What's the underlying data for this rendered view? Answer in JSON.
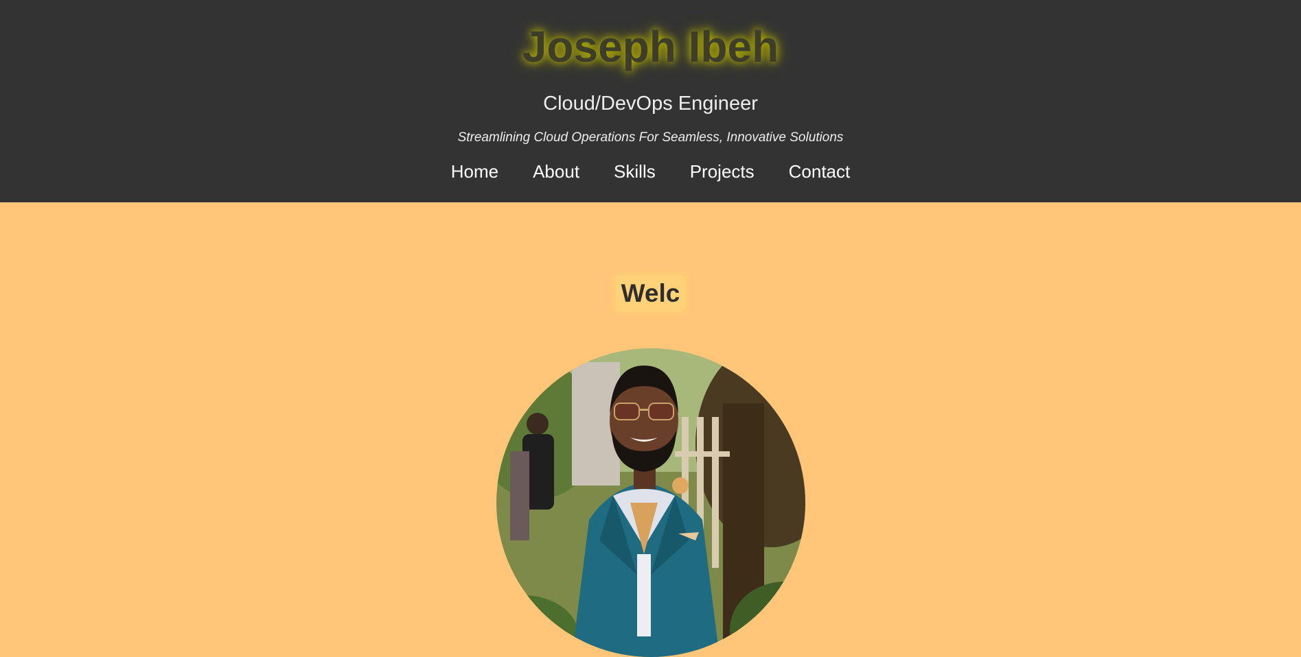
{
  "header": {
    "name": "Joseph Ibeh",
    "role": "Cloud/DevOps Engineer",
    "tagline": "Streamlining Cloud Operations For Seamless, Innovative Solutions"
  },
  "nav": {
    "items": [
      {
        "label": "Home"
      },
      {
        "label": "About"
      },
      {
        "label": "Skills"
      },
      {
        "label": "Projects"
      },
      {
        "label": "Contact"
      }
    ]
  },
  "hero": {
    "welcome_text": "Welc",
    "profile_photo": "profile-photo"
  },
  "colors": {
    "header_bg": "#333333",
    "page_bg": "#ffc67a",
    "name_glow": "#c7c400",
    "welcome_bg": "#ffd27a"
  }
}
